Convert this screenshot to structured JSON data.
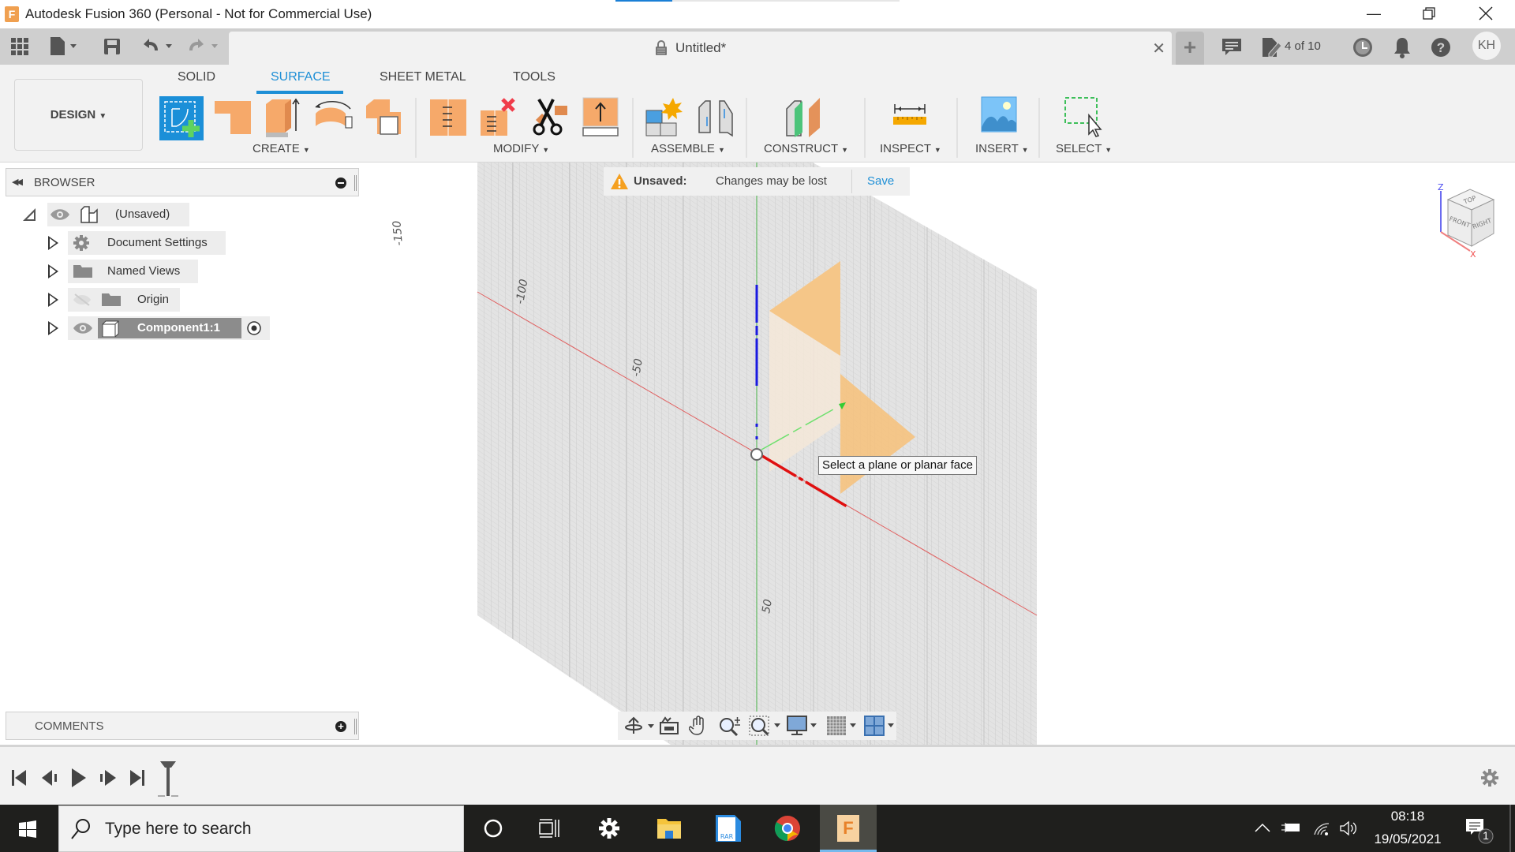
{
  "window": {
    "title": "Autodesk Fusion 360 (Personal - Not for Commercial Use)",
    "controls": [
      "minimize",
      "restore",
      "close"
    ]
  },
  "toolbar": {
    "document_title": "Untitled*",
    "version_counter": "4 of 10",
    "user_initials": "KH",
    "icons": [
      "app-grid-icon",
      "file-icon",
      "save-icon",
      "undo-icon",
      "redo-icon",
      "lock-icon",
      "close-tab-icon",
      "new-tab-icon",
      "comments-icon",
      "versions-icon",
      "job-status-icon",
      "notifications-icon",
      "help-icon"
    ]
  },
  "ribbon": {
    "workspace": "DESIGN",
    "tabs": [
      {
        "label": "SOLID",
        "active": false
      },
      {
        "label": "SURFACE",
        "active": true
      },
      {
        "label": "SHEET METAL",
        "active": false
      },
      {
        "label": "TOOLS",
        "active": false
      }
    ],
    "groups": [
      {
        "label": "CREATE",
        "tools": [
          "create-sketch",
          "extrude-surface",
          "extrude",
          "revolve",
          "offset"
        ]
      },
      {
        "label": "MODIFY",
        "tools": [
          "split-face",
          "delete-face",
          "trim",
          "press-pull"
        ]
      },
      {
        "label": "ASSEMBLE",
        "tools": [
          "new-component",
          "joint"
        ]
      },
      {
        "label": "CONSTRUCT",
        "tools": [
          "offset-plane"
        ]
      },
      {
        "label": "INSPECT",
        "tools": [
          "measure"
        ]
      },
      {
        "label": "INSERT",
        "tools": [
          "insert-image"
        ]
      },
      {
        "label": "SELECT",
        "tools": [
          "window-select"
        ]
      }
    ]
  },
  "browser": {
    "title": "BROWSER",
    "items": [
      {
        "label": "(Unsaved)",
        "level": 0,
        "expanded": true,
        "visible": true
      },
      {
        "label": "Document Settings",
        "level": 1,
        "expanded": false
      },
      {
        "label": "Named Views",
        "level": 1,
        "expanded": false
      },
      {
        "label": "Origin",
        "level": 1,
        "expanded": false,
        "visible": false
      },
      {
        "label": "Component1:1",
        "level": 1,
        "expanded": false,
        "visible": true,
        "active": true
      }
    ]
  },
  "comments": {
    "title": "COMMENTS"
  },
  "viewport": {
    "notice": {
      "title": "Unsaved:",
      "message": "Changes may be lost",
      "action": "Save"
    },
    "tooltip": "Select a plane or planar face",
    "grid_labels": [
      "-150",
      "-100",
      "-50",
      "50"
    ],
    "viewcube": {
      "faces": [
        "TOP",
        "FRONT",
        "RIGHT"
      ],
      "axes": [
        "Z",
        "X"
      ]
    },
    "colors": {
      "x_axis": "#e02020",
      "y_axis": "#20a020",
      "z_axis": "#1a1ae0",
      "plane_preview": "#f5c07a"
    }
  },
  "navbar": {
    "tools": [
      "orbit",
      "look-at",
      "pan",
      "zoom",
      "fit",
      "display-settings",
      "grid-snaps",
      "viewports"
    ]
  },
  "timeline": {
    "controls": [
      "go-to-start",
      "step-back",
      "play",
      "step-forward",
      "go-to-end"
    ]
  },
  "taskbar": {
    "search_placeholder": "Type here to search",
    "apps": [
      "cortana",
      "task-view",
      "settings",
      "file-explorer",
      "winrar",
      "chrome",
      "fusion-360"
    ],
    "time": "08:18",
    "date": "19/05/2021",
    "notification_count": "1"
  }
}
